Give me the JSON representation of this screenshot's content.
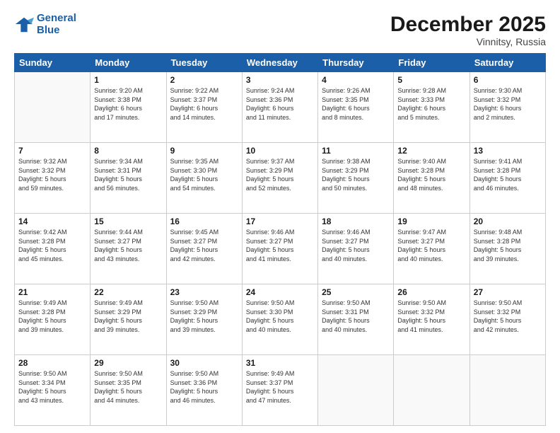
{
  "header": {
    "logo_line1": "General",
    "logo_line2": "Blue",
    "month_year": "December 2025",
    "location": "Vinnitsy, Russia"
  },
  "days_of_week": [
    "Sunday",
    "Monday",
    "Tuesday",
    "Wednesday",
    "Thursday",
    "Friday",
    "Saturday"
  ],
  "weeks": [
    [
      {
        "num": "",
        "info": ""
      },
      {
        "num": "1",
        "info": "Sunrise: 9:20 AM\nSunset: 3:38 PM\nDaylight: 6 hours\nand 17 minutes."
      },
      {
        "num": "2",
        "info": "Sunrise: 9:22 AM\nSunset: 3:37 PM\nDaylight: 6 hours\nand 14 minutes."
      },
      {
        "num": "3",
        "info": "Sunrise: 9:24 AM\nSunset: 3:36 PM\nDaylight: 6 hours\nand 11 minutes."
      },
      {
        "num": "4",
        "info": "Sunrise: 9:26 AM\nSunset: 3:35 PM\nDaylight: 6 hours\nand 8 minutes."
      },
      {
        "num": "5",
        "info": "Sunrise: 9:28 AM\nSunset: 3:33 PM\nDaylight: 6 hours\nand 5 minutes."
      },
      {
        "num": "6",
        "info": "Sunrise: 9:30 AM\nSunset: 3:32 PM\nDaylight: 6 hours\nand 2 minutes."
      }
    ],
    [
      {
        "num": "7",
        "info": "Sunrise: 9:32 AM\nSunset: 3:32 PM\nDaylight: 5 hours\nand 59 minutes."
      },
      {
        "num": "8",
        "info": "Sunrise: 9:34 AM\nSunset: 3:31 PM\nDaylight: 5 hours\nand 56 minutes."
      },
      {
        "num": "9",
        "info": "Sunrise: 9:35 AM\nSunset: 3:30 PM\nDaylight: 5 hours\nand 54 minutes."
      },
      {
        "num": "10",
        "info": "Sunrise: 9:37 AM\nSunset: 3:29 PM\nDaylight: 5 hours\nand 52 minutes."
      },
      {
        "num": "11",
        "info": "Sunrise: 9:38 AM\nSunset: 3:29 PM\nDaylight: 5 hours\nand 50 minutes."
      },
      {
        "num": "12",
        "info": "Sunrise: 9:40 AM\nSunset: 3:28 PM\nDaylight: 5 hours\nand 48 minutes."
      },
      {
        "num": "13",
        "info": "Sunrise: 9:41 AM\nSunset: 3:28 PM\nDaylight: 5 hours\nand 46 minutes."
      }
    ],
    [
      {
        "num": "14",
        "info": "Sunrise: 9:42 AM\nSunset: 3:28 PM\nDaylight: 5 hours\nand 45 minutes."
      },
      {
        "num": "15",
        "info": "Sunrise: 9:44 AM\nSunset: 3:27 PM\nDaylight: 5 hours\nand 43 minutes."
      },
      {
        "num": "16",
        "info": "Sunrise: 9:45 AM\nSunset: 3:27 PM\nDaylight: 5 hours\nand 42 minutes."
      },
      {
        "num": "17",
        "info": "Sunrise: 9:46 AM\nSunset: 3:27 PM\nDaylight: 5 hours\nand 41 minutes."
      },
      {
        "num": "18",
        "info": "Sunrise: 9:46 AM\nSunset: 3:27 PM\nDaylight: 5 hours\nand 40 minutes."
      },
      {
        "num": "19",
        "info": "Sunrise: 9:47 AM\nSunset: 3:27 PM\nDaylight: 5 hours\nand 40 minutes."
      },
      {
        "num": "20",
        "info": "Sunrise: 9:48 AM\nSunset: 3:28 PM\nDaylight: 5 hours\nand 39 minutes."
      }
    ],
    [
      {
        "num": "21",
        "info": "Sunrise: 9:49 AM\nSunset: 3:28 PM\nDaylight: 5 hours\nand 39 minutes."
      },
      {
        "num": "22",
        "info": "Sunrise: 9:49 AM\nSunset: 3:29 PM\nDaylight: 5 hours\nand 39 minutes."
      },
      {
        "num": "23",
        "info": "Sunrise: 9:50 AM\nSunset: 3:29 PM\nDaylight: 5 hours\nand 39 minutes."
      },
      {
        "num": "24",
        "info": "Sunrise: 9:50 AM\nSunset: 3:30 PM\nDaylight: 5 hours\nand 40 minutes."
      },
      {
        "num": "25",
        "info": "Sunrise: 9:50 AM\nSunset: 3:31 PM\nDaylight: 5 hours\nand 40 minutes."
      },
      {
        "num": "26",
        "info": "Sunrise: 9:50 AM\nSunset: 3:32 PM\nDaylight: 5 hours\nand 41 minutes."
      },
      {
        "num": "27",
        "info": "Sunrise: 9:50 AM\nSunset: 3:32 PM\nDaylight: 5 hours\nand 42 minutes."
      }
    ],
    [
      {
        "num": "28",
        "info": "Sunrise: 9:50 AM\nSunset: 3:34 PM\nDaylight: 5 hours\nand 43 minutes."
      },
      {
        "num": "29",
        "info": "Sunrise: 9:50 AM\nSunset: 3:35 PM\nDaylight: 5 hours\nand 44 minutes."
      },
      {
        "num": "30",
        "info": "Sunrise: 9:50 AM\nSunset: 3:36 PM\nDaylight: 5 hours\nand 46 minutes."
      },
      {
        "num": "31",
        "info": "Sunrise: 9:49 AM\nSunset: 3:37 PM\nDaylight: 5 hours\nand 47 minutes."
      },
      {
        "num": "",
        "info": ""
      },
      {
        "num": "",
        "info": ""
      },
      {
        "num": "",
        "info": ""
      }
    ]
  ]
}
